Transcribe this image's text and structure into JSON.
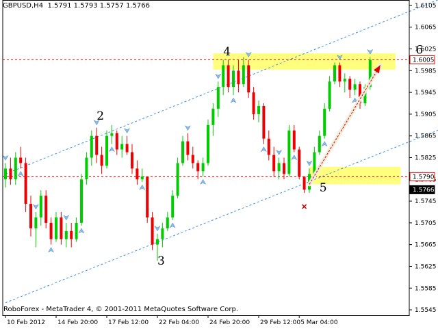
{
  "header": {
    "symbol": "GBPUSD,H4",
    "ohlc": "1.5791 1.5793 1.5757 1.5766"
  },
  "footer": {
    "copyright": "RoboForex - MetaTrader 4, © 2001-2011 MetaQuotes Software Corp."
  },
  "colors": {
    "bull": "#00cc00",
    "bear": "#ee0000",
    "channel": "#3a8ee6",
    "zone": "#ffff66",
    "level_line": "#dd0000",
    "arrow_marker": "#88bbee"
  },
  "chart_data": {
    "type": "candlestick",
    "title": "GBPUSD,H4",
    "ylim": [
      1.5535,
      1.6115
    ],
    "y_ticks": [
      "1.6105",
      "1.6065",
      "1.6025",
      "1.5985",
      "1.5945",
      "1.5905",
      "1.5865",
      "1.5825",
      "1.5785",
      "1.5745",
      "1.5705",
      "1.5665",
      "1.5625",
      "1.5585",
      "1.5545"
    ],
    "x_ticks": [
      "10 Feb 2012",
      "14 Feb 20:00",
      "17 Feb 12:00",
      "22 Feb 04:00",
      "24 Feb 20:00",
      "29 Feb 12:00",
      "5 Mar 04:00"
    ],
    "price_tags": [
      {
        "label": "1.6005",
        "value": 1.6005,
        "style": "outline"
      },
      {
        "label": "1.5790",
        "value": 1.579,
        "style": "outline"
      },
      {
        "label": "1.5766",
        "value": 1.5766,
        "style": "filled"
      }
    ],
    "horizontal_levels": [
      1.6005,
      1.579
    ],
    "zones": [
      {
        "x_from": 41,
        "x_to": 77,
        "y_from": 1.5987,
        "y_to": 1.6017
      },
      {
        "x_from": 60,
        "x_to": 78,
        "y_from": 1.5776,
        "y_to": 1.5808
      }
    ],
    "channel_lines": [
      {
        "from": [
          0,
          1.5795
        ],
        "to": [
          88,
          1.6125
        ]
      },
      {
        "from": [
          0,
          1.5558
        ],
        "to": [
          88,
          1.5885
        ]
      }
    ],
    "wave_labels": [
      {
        "label": "2",
        "x": 18,
        "y": 1.5895
      },
      {
        "label": "3",
        "x": 30,
        "y": 1.5628
      },
      {
        "label": "4",
        "x": 43,
        "y": 1.6013
      },
      {
        "label": "5",
        "x": 62,
        "y": 1.5763
      },
      {
        "label": "6",
        "x": 81,
        "y": 1.6016
      }
    ],
    "forecast_arrow": {
      "from": [
        60,
        1.5776
      ],
      "to": [
        74,
        1.5995
      ]
    },
    "marker_x": {
      "x": 59,
      "y": 1.5735
    },
    "candles": [
      [
        1.5785,
        1.5815,
        1.577,
        1.5805
      ],
      [
        1.5805,
        1.5825,
        1.5775,
        1.5785
      ],
      [
        1.5785,
        1.5835,
        1.5775,
        1.5825
      ],
      [
        1.5825,
        1.5845,
        1.5805,
        1.5815
      ],
      [
        1.5815,
        1.5825,
        1.5725,
        1.574
      ],
      [
        1.574,
        1.5755,
        1.568,
        1.5695
      ],
      [
        1.5695,
        1.5725,
        1.566,
        1.5715
      ],
      [
        1.5715,
        1.5765,
        1.57,
        1.5755
      ],
      [
        1.5755,
        1.5765,
        1.5695,
        1.5705
      ],
      [
        1.5705,
        1.5715,
        1.5665,
        1.5675
      ],
      [
        1.5675,
        1.5725,
        1.567,
        1.5715
      ],
      [
        1.5715,
        1.5725,
        1.5665,
        1.5675
      ],
      [
        1.5675,
        1.5705,
        1.566,
        1.569
      ],
      [
        1.569,
        1.5705,
        1.566,
        1.5675
      ],
      [
        1.5675,
        1.5715,
        1.567,
        1.5705
      ],
      [
        1.5705,
        1.5795,
        1.57,
        1.5785
      ],
      [
        1.5785,
        1.5835,
        1.5775,
        1.5825
      ],
      [
        1.5825,
        1.5875,
        1.581,
        1.5865
      ],
      [
        1.5865,
        1.588,
        1.5815,
        1.583
      ],
      [
        1.583,
        1.5845,
        1.5795,
        1.581
      ],
      [
        1.581,
        1.5875,
        1.5805,
        1.5865
      ],
      [
        1.5865,
        1.5885,
        1.585,
        1.587
      ],
      [
        1.587,
        1.5875,
        1.583,
        1.584
      ],
      [
        1.584,
        1.5865,
        1.5825,
        1.585
      ],
      [
        1.585,
        1.5865,
        1.583,
        1.5835
      ],
      [
        1.5835,
        1.585,
        1.5795,
        1.5805
      ],
      [
        1.5805,
        1.582,
        1.5775,
        1.5785
      ],
      [
        1.5785,
        1.5805,
        1.578,
        1.579
      ],
      [
        1.579,
        1.579,
        1.5705,
        1.5715
      ],
      [
        1.5715,
        1.5725,
        1.5655,
        1.5665
      ],
      [
        1.5665,
        1.5685,
        1.5635,
        1.5675
      ],
      [
        1.5675,
        1.5705,
        1.566,
        1.5695
      ],
      [
        1.5695,
        1.5725,
        1.569,
        1.5715
      ],
      [
        1.5715,
        1.5765,
        1.571,
        1.5755
      ],
      [
        1.5755,
        1.5825,
        1.575,
        1.5815
      ],
      [
        1.5815,
        1.5865,
        1.581,
        1.5855
      ],
      [
        1.5855,
        1.587,
        1.582,
        1.583
      ],
      [
        1.583,
        1.5845,
        1.5805,
        1.5815
      ],
      [
        1.5815,
        1.582,
        1.5785,
        1.58
      ],
      [
        1.58,
        1.5825,
        1.579,
        1.5815
      ],
      [
        1.5815,
        1.5895,
        1.581,
        1.5885
      ],
      [
        1.5885,
        1.5925,
        1.5865,
        1.5915
      ],
      [
        1.5915,
        1.5965,
        1.59,
        1.5955
      ],
      [
        1.5955,
        1.6005,
        1.594,
        1.5995
      ],
      [
        1.5995,
        1.6005,
        1.5945,
        1.5955
      ],
      [
        1.5955,
        1.5995,
        1.594,
        1.5985
      ],
      [
        1.5985,
        1.6005,
        1.5945,
        1.596
      ],
      [
        1.596,
        1.601,
        1.5955,
        1.5995
      ],
      [
        1.5995,
        1.6005,
        1.5935,
        1.5945
      ],
      [
        1.5945,
        1.5955,
        1.5895,
        1.5905
      ],
      [
        1.5905,
        1.593,
        1.589,
        1.592
      ],
      [
        1.592,
        1.5925,
        1.585,
        1.586
      ],
      [
        1.586,
        1.5875,
        1.582,
        1.583
      ],
      [
        1.583,
        1.5845,
        1.579,
        1.58
      ],
      [
        1.58,
        1.5825,
        1.5785,
        1.5815
      ],
      [
        1.5815,
        1.5825,
        1.5785,
        1.5795
      ],
      [
        1.5795,
        1.5885,
        1.579,
        1.5875
      ],
      [
        1.5875,
        1.5885,
        1.5835,
        1.584
      ],
      [
        1.584,
        1.5845,
        1.5785,
        1.579
      ],
      [
        1.579,
        1.579,
        1.576,
        1.5766
      ],
      [
        1.5766,
        1.5805,
        1.576,
        1.5795
      ],
      [
        1.5795,
        1.5845,
        1.579,
        1.5835
      ],
      [
        1.5835,
        1.5875,
        1.583,
        1.5865
      ],
      [
        1.5865,
        1.5925,
        1.586,
        1.5915
      ],
      [
        1.5915,
        1.5975,
        1.591,
        1.5965
      ],
      [
        1.5965,
        1.6,
        1.596,
        1.5995
      ],
      [
        1.5995,
        1.6,
        1.5955,
        1.5965
      ],
      [
        1.5965,
        1.598,
        1.5945,
        1.597
      ],
      [
        1.597,
        1.5975,
        1.5935,
        1.595
      ],
      [
        1.595,
        1.597,
        1.594,
        1.596
      ],
      [
        1.596,
        1.5965,
        1.5915,
        1.5925
      ],
      [
        1.5925,
        1.596,
        1.592,
        1.5955
      ],
      [
        1.5955,
        1.601,
        1.595,
        1.6005
      ]
    ]
  }
}
